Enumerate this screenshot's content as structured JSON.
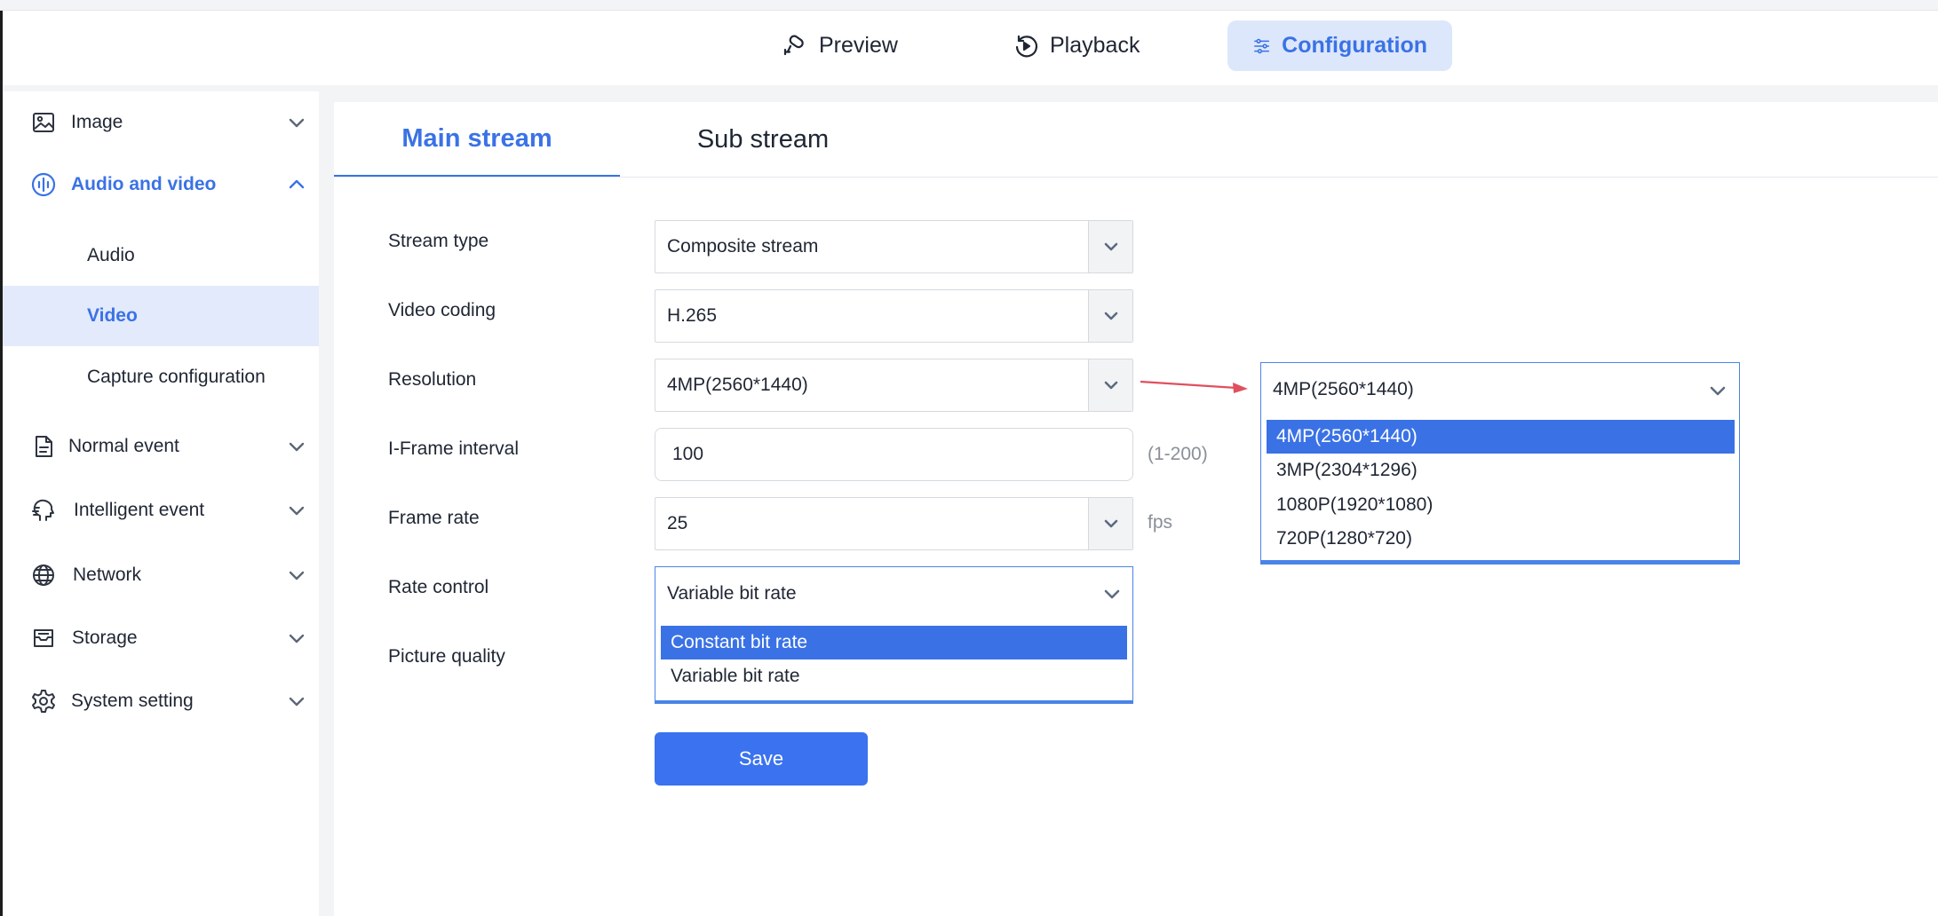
{
  "topnav": {
    "preview": "Preview",
    "playback": "Playback",
    "configuration": "Configuration"
  },
  "sidebar": {
    "items": [
      {
        "label": "Image",
        "icon": "image-icon"
      },
      {
        "label": "Audio and video",
        "icon": "audio-video-icon"
      },
      {
        "label": "Normal event",
        "icon": "document-icon"
      },
      {
        "label": "Intelligent event",
        "icon": "brain-icon"
      },
      {
        "label": "Network",
        "icon": "globe-icon"
      },
      {
        "label": "Storage",
        "icon": "storage-icon"
      },
      {
        "label": "System setting",
        "icon": "gear-icon"
      }
    ],
    "sub_items": [
      {
        "label": "Audio"
      },
      {
        "label": "Video"
      },
      {
        "label": "Capture configuration"
      }
    ]
  },
  "tabs": {
    "main_stream": "Main stream",
    "sub_stream": "Sub stream"
  },
  "form": {
    "stream_type": {
      "label": "Stream type",
      "value": "Composite stream"
    },
    "video_coding": {
      "label": "Video coding",
      "value": "H.265"
    },
    "resolution": {
      "label": "Resolution",
      "value": "4MP(2560*1440)"
    },
    "iframe_interval": {
      "label": "I-Frame interval",
      "value": "100",
      "hint": "(1-200)"
    },
    "frame_rate": {
      "label": "Frame rate",
      "value": "25",
      "unit": "fps"
    },
    "rate_control": {
      "label": "Rate control",
      "value": "Variable bit rate",
      "options": [
        "Constant bit rate",
        "Variable bit rate"
      ]
    },
    "picture_quality": {
      "label": "Picture quality"
    },
    "save": "Save"
  },
  "resolution_dropdown": {
    "value": "4MP(2560*1440)",
    "options": [
      "4MP(2560*1440)",
      "3MP(2304*1296)",
      "1080P(1920*1080)",
      "720P(1280*720)"
    ]
  },
  "colors": {
    "accent": "#3a72e6",
    "save_button": "#3a72f0",
    "arrow": "#e0505e",
    "selected_bg": "#e2eafc"
  }
}
